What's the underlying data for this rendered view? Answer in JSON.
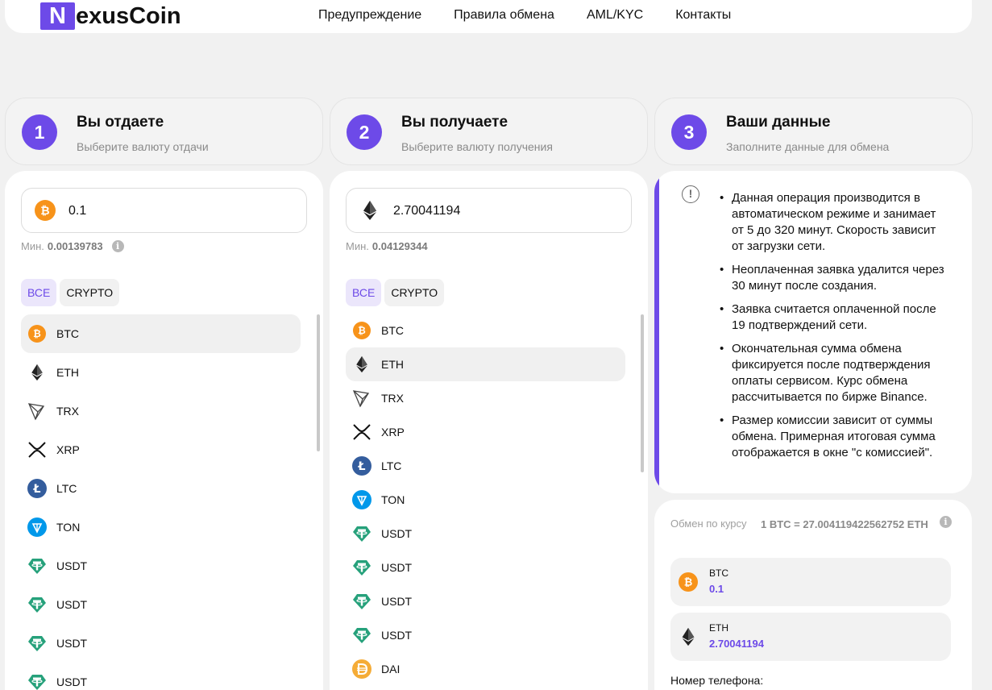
{
  "header": {
    "logo_letter": "N",
    "logo_rest": "exusCoin",
    "nav": [
      "Предупреждение",
      "Правила обмена",
      "AML/KYC",
      "Контакты"
    ]
  },
  "steps": [
    {
      "num": "1",
      "title": "Вы отдаете",
      "subtitle": "Выберите валюту отдачи"
    },
    {
      "num": "2",
      "title": "Вы получаете",
      "subtitle": "Выберите валюту получения"
    },
    {
      "num": "3",
      "title": "Ваши данные",
      "subtitle": "Заполните данные для обмена"
    }
  ],
  "give": {
    "amount": "0.1",
    "min_label": "Мин.",
    "min_value": "0.00139783",
    "filters": [
      "ВСЕ",
      "CRYPTO"
    ],
    "selected": "BTC",
    "currencies": [
      "BTC",
      "ETH",
      "TRX",
      "XRP",
      "LTC",
      "TON",
      "USDT",
      "USDT",
      "USDT",
      "USDT"
    ]
  },
  "receive": {
    "amount": "2.70041194",
    "min_label": "Мин.",
    "min_value": "0.04129344",
    "filters": [
      "ВСЕ",
      "CRYPTO"
    ],
    "selected": "ETH",
    "currencies": [
      "BTC",
      "ETH",
      "TRX",
      "XRP",
      "LTC",
      "TON",
      "USDT",
      "USDT",
      "USDT",
      "USDT",
      "DAI"
    ]
  },
  "notice": {
    "items": [
      "Данная операция производится в автоматическом режиме и занимает от 5 до 320 минут. Скорость зависит от загрузки сети.",
      "Неоплаченная заявка удалится через 30 минут после создания.",
      "Заявка считается оплаченной после 19 подтверждений сети.",
      "Окончательная сумма обмена фиксируется после подтверждения оплаты сервисом. Курс обмена рассчитывается по бирже Binance.",
      "Размер комиссии зависит от суммы обмена. Примерная итоговая сумма отображается в окне \"с комиссией\"."
    ]
  },
  "exchange": {
    "rate_label": "Обмен по курсу",
    "rate_value": "1 BTC = 27.004119422562752 ETH",
    "from": {
      "code": "BTC",
      "amount": "0.1"
    },
    "to": {
      "code": "ETH",
      "amount": "2.70041194"
    },
    "phone_label": "Номер телефона:"
  },
  "colors": {
    "accent": "#6d4ae8",
    "btc": "#f7931a",
    "usdt": "#26a17b",
    "ltc": "#345d9d",
    "ton": "#0098ea",
    "dai": "#f5ac37"
  }
}
